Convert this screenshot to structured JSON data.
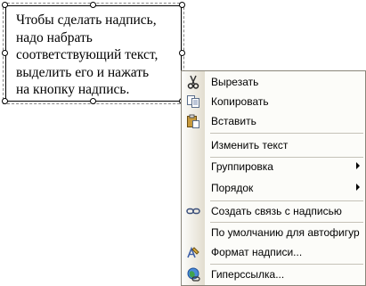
{
  "textbox": {
    "lines": [
      "Чтобы сделать надпись,",
      "надо набрать",
      "соответствующий текст,",
      "выделить его и нажать",
      "на кнопку надпись."
    ]
  },
  "context_menu": {
    "items": [
      {
        "label": "Вырезать",
        "icon": "scissors-icon"
      },
      {
        "label": "Копировать",
        "icon": "copy-icon"
      },
      {
        "label": "Вставить",
        "icon": "paste-icon"
      },
      {
        "label": "Изменить текст"
      },
      {
        "label": "Группировка",
        "submenu": true
      },
      {
        "label": "Порядок",
        "submenu": true
      },
      {
        "label": "Создать связь с надписью",
        "icon": "link-icon"
      },
      {
        "label": "По умолчанию для автофигур"
      },
      {
        "label": "Формат надписи...",
        "icon": "format-icon"
      },
      {
        "label": "Гиперссылка...",
        "icon": "hyperlink-icon"
      }
    ]
  }
}
